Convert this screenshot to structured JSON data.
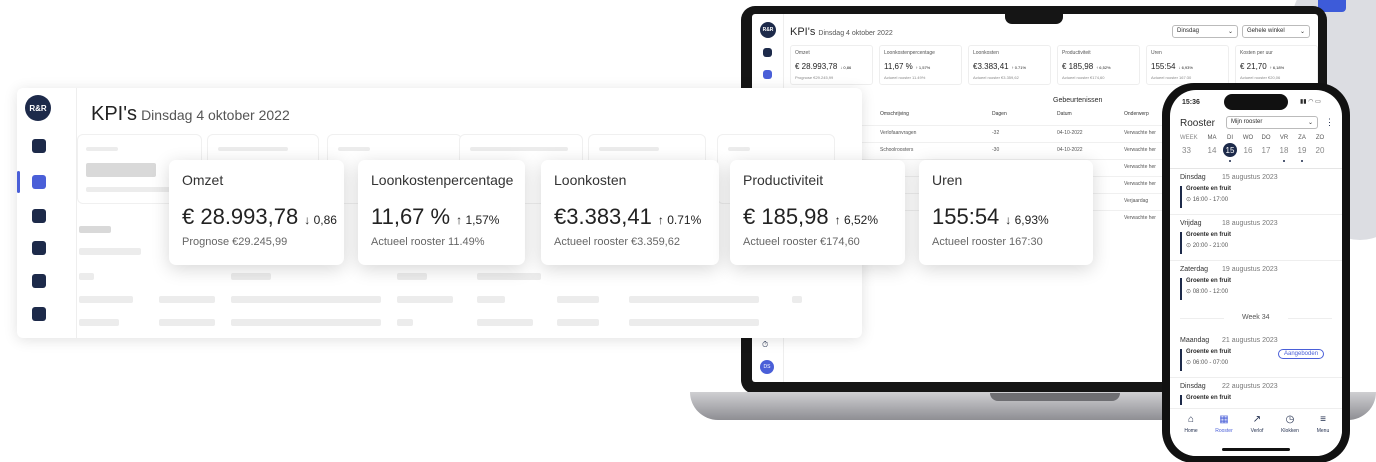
{
  "app": {
    "logo": "R&R",
    "title": "KPI's",
    "date": "Dinsdag 4 oktober 2022"
  },
  "kpis": [
    {
      "label": "Omzet",
      "value": "€ 28.993,78",
      "change": "↓ 0,86",
      "footer": "Prognose €29.245,99"
    },
    {
      "label": "Loonkostenpercentage",
      "value": "11,67 %",
      "change": "↑ 1,57%",
      "footer": "Actueel rooster 11.49%"
    },
    {
      "label": "Loonkosten",
      "value": "€3.383,41",
      "change": "↑ 0.71%",
      "footer": "Actueel rooster €3.359,62"
    },
    {
      "label": "Productiviteit",
      "value": "€ 185,98",
      "change": "↑ 6,52%",
      "footer": "Actueel rooster €174,60"
    },
    {
      "label": "Uren",
      "value": "155:54",
      "change": "↓ 6,93%",
      "footer": "Actueel rooster 167:30"
    }
  ],
  "laptop": {
    "title": "KPI's",
    "date": "Dinsdag 4 oktober 2022",
    "select_day": "Dinsdag",
    "select_store": "Gehele winkel",
    "kpis": [
      {
        "label": "Omzet",
        "value": "€ 28.993,78",
        "change": "↓ 0,86",
        "footer": "Prognose €29.245,99"
      },
      {
        "label": "Loonkostenpercentage",
        "value": "11,67 %",
        "change": "↑ 1,57%",
        "footer": "Actueel rooster 11.49%"
      },
      {
        "label": "Loonkosten",
        "value": "€3.383,41",
        "change": "↑ 0.71%",
        "footer": "Actueel rooster €3.359,62"
      },
      {
        "label": "Productiviteit",
        "value": "€ 185,98",
        "change": "↑ 6,52%",
        "footer": "Actueel rooster €174,60"
      },
      {
        "label": "Uren",
        "value": "155:54",
        "change": "↓ 6,93%",
        "footer": "Actueel rooster 167:30"
      },
      {
        "label": "Kosten per uur",
        "value": "€ 21,70",
        "change": "↑ 6,18%",
        "footer": "Actueel rooster €20,06"
      }
    ],
    "events_title": "Gebeurtenissen",
    "table_headers": [
      "orie",
      "Omschrijving",
      "Dagen",
      "Datum",
      "Onderwerp"
    ],
    "table_rows": [
      [
        "reen",
        "Verlofaanvragen",
        "-32",
        "04-10-2022",
        "Verwachte her"
      ],
      [
        "reen",
        "Schoolroosters",
        "-30",
        "04-10-2022",
        "Verwachte her"
      ],
      [
        "",
        "sche",
        "",
        "",
        "Verwachte her"
      ],
      [
        "",
        "mels",
        "",
        "",
        "Verwachte her"
      ],
      [
        "",
        "ater",
        "",
        "",
        "Verjaardag"
      ],
      [
        "",
        "gnose",
        "",
        "",
        "Verwachte her"
      ]
    ],
    "avatar": "DS"
  },
  "phone": {
    "time": "15:36",
    "title": "Rooster",
    "select": "Mijn rooster",
    "week_label": "WEEK",
    "days": [
      "MA",
      "DI",
      "WO",
      "DO",
      "VR",
      "ZA",
      "ZO"
    ],
    "week_num": "33",
    "dates": [
      "14",
      "15",
      "16",
      "17",
      "18",
      "19",
      "20"
    ],
    "entries": [
      {
        "day": "Dinsdag",
        "date": "15 augustus 2023",
        "shift": "Groente en fruit",
        "time": "16:00 - 17:00"
      },
      {
        "day": "Vrijdag",
        "date": "18 augustus 2023",
        "shift": "Groente en fruit",
        "time": "20:00 - 21:00"
      },
      {
        "day": "Zaterdag",
        "date": "19 augustus 2023",
        "shift": "Groente en fruit",
        "time": "08:00 - 12:00"
      }
    ],
    "week_divider": "Week 34",
    "entries2": [
      {
        "day": "Maandag",
        "date": "21 augustus 2023",
        "shift": "Groente en fruit",
        "time": "06:00 - 07:00",
        "badge": "Aangeboden"
      },
      {
        "day": "Dinsdag",
        "date": "22 augustus 2023",
        "shift": "Groente en fruit"
      }
    ],
    "nav": [
      "Home",
      "Rooster",
      "Verlof",
      "Klokken",
      "Menu"
    ]
  },
  "colors": {
    "navy": "#1d2a4a",
    "accent": "#4a5fd8"
  }
}
